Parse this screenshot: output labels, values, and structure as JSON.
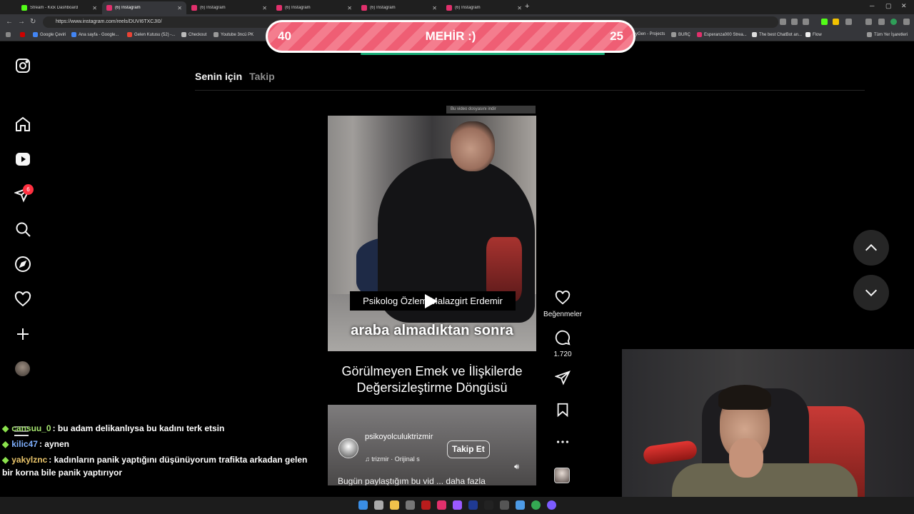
{
  "browser": {
    "tabs": [
      {
        "label": "Stream - Kick Dashboard",
        "color": "#53fc18",
        "active": false
      },
      {
        "label": "(6) Instagram",
        "color": "#e1306c",
        "active": true
      },
      {
        "label": "(6) Instagram",
        "color": "#e1306c",
        "active": false
      },
      {
        "label": "(6) Instagram",
        "color": "#e1306c",
        "active": false
      },
      {
        "label": "(6) Instagram",
        "color": "#e1306c",
        "active": false
      },
      {
        "label": "(6) Instagram",
        "color": "#e1306c",
        "active": false
      }
    ],
    "url": "https://www.instagram.com/reels/DUVI6TXCJI0/",
    "bookmarks_left": [
      "Google Çeviri",
      "Ana sayfa - Google...",
      "Gelen Kutusu (52) -...",
      "Checkout",
      "Youtube 3ncü PK"
    ],
    "bookmarks_right": [
      "...yGen - Projects",
      "BURÇ",
      "Esperanza000 Strea...",
      "The best ChatBot an...",
      "Flow"
    ],
    "bookmarks_all": "Tüm Yer İşaretleri"
  },
  "overlay": {
    "left_number": "40",
    "title": "MEHİR :)",
    "right_number": "25"
  },
  "instagram": {
    "notifications_count": "6",
    "feed_tabs": {
      "for_you": "Senin için",
      "following": "Takip"
    },
    "reel": {
      "download_notice": "Bu video dosyasını indir",
      "speaker_label": "Psikolog Özlem Malazgirt Erdemir",
      "caption_big": "araba almadıktan sonra",
      "caption_line1": "Görülmeyen Emek ve İlişkilerde",
      "caption_line2": "Değersizleştirme Döngüsü",
      "author": "psikoyolculuktrizmir",
      "audio": "trizmir · Orijinal s",
      "follow_label": "Takip Et",
      "description": "Bugün paylaştığım bu vid ... daha fazla"
    },
    "actions": {
      "likes_label": "Beğenmeler",
      "comments_count": "1.720"
    }
  },
  "chat": [
    {
      "user": "cansuu_0",
      "user_color": "#a4e36f",
      "message": ": bu adam delikanlıysa bu kadını terk etsin"
    },
    {
      "user": "kilic47",
      "user_color": "#7fb0ff",
      "message": ": aynen"
    },
    {
      "user": "yakylznc",
      "user_color": "#e9c46a",
      "message": ": kadınların panik yaptığını düşünüyorum trafikta arkadan gelen bir korna bile panik yaptırıyor"
    }
  ]
}
